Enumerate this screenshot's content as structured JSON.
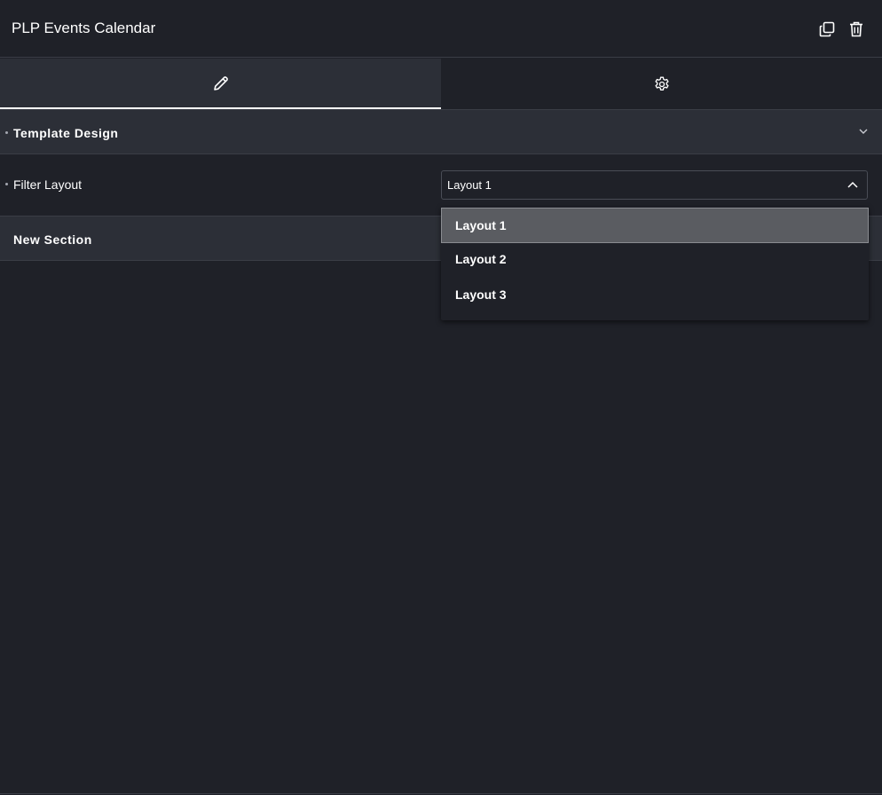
{
  "panel": {
    "title": "PLP Events Calendar"
  },
  "header_actions": [
    {
      "icon": "duplicate-icon",
      "label": ""
    },
    {
      "icon": "trash-icon",
      "label": ""
    }
  ],
  "tabs": [
    {
      "icon": "pencil-icon",
      "active": true
    },
    {
      "icon": "gear-icon",
      "active": false
    }
  ],
  "sections": {
    "template_design": {
      "label": "Template Design",
      "expanded": true
    },
    "new_section": {
      "label": "New Section",
      "expanded": false
    }
  },
  "filter_layout": {
    "label": "Filter Layout",
    "selected": "Layout 1",
    "options": [
      "Layout 1",
      "Layout 2",
      "Layout 3"
    ]
  },
  "colors": {
    "background": "#1f2128",
    "section_background": "#2c2f37",
    "border": "#3a3d46",
    "selected_option": "#5a5c61",
    "text": "#ffffff"
  }
}
